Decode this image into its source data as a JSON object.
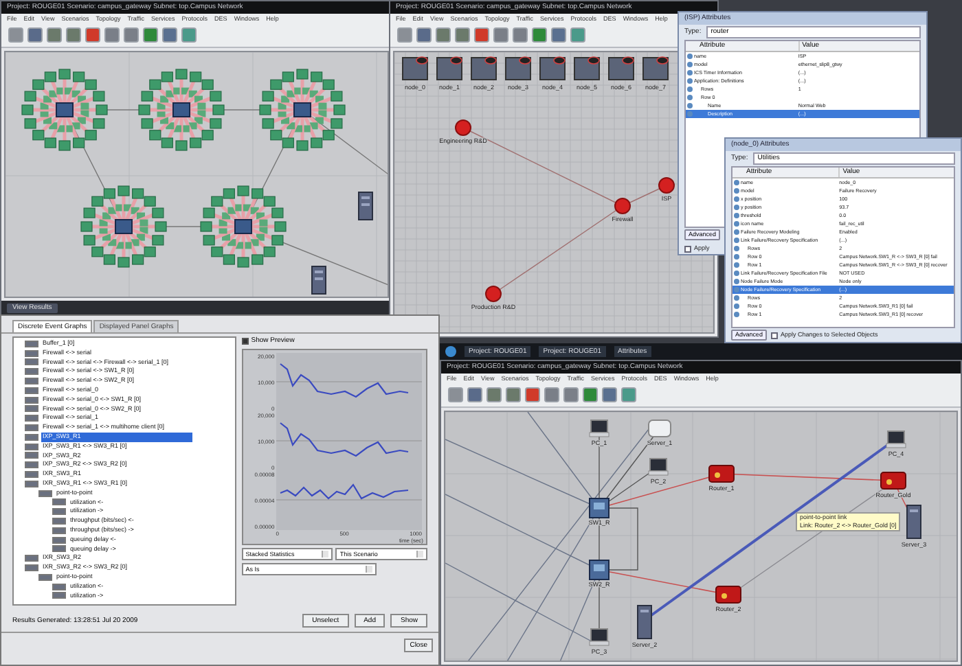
{
  "editor_top_left": {
    "title": "Project: ROUGE01 Scenario: campus_gateway Subnet: top.Campus Network",
    "menu": [
      "File",
      "Edit",
      "View",
      "Scenarios",
      "Topology",
      "Traffic",
      "Services",
      "Protocols",
      "DES",
      "Windows",
      "Help"
    ],
    "minimized": "View Results"
  },
  "editor_top_center": {
    "title": "Project: ROUGE01 Scenario: campus_gateway Subnet: top.Campus Network",
    "menu": [
      "File",
      "Edit",
      "View",
      "Scenarios",
      "Topology",
      "Traffic",
      "Services",
      "Protocols",
      "DES",
      "Windows",
      "Help"
    ],
    "palette": [
      "node_0",
      "node_1",
      "node_2",
      "node_3",
      "node_4",
      "node_5",
      "node_6",
      "node_7"
    ],
    "sites": [
      "Engineering R&D",
      "Firewall",
      "ISP",
      "Production R&D"
    ]
  },
  "attributes_window": {
    "title": "(ISP) Attributes",
    "type_label": "Type:",
    "type_value": "router",
    "columns": [
      "Attribute",
      "Value"
    ],
    "rows": [
      {
        "attribute": "name",
        "value": "ISP",
        "selected": false
      },
      {
        "attribute": "model",
        "value": "ethernet_slip8_gtwy",
        "selected": false
      },
      {
        "attribute": "ICS Timer Information",
        "value": "(...)",
        "selected": false
      },
      {
        "attribute": "Application: Definitions",
        "value": "(...)",
        "selected": false,
        "children": [
          {
            "attribute": "Rows",
            "value": "1",
            "selected": false
          },
          {
            "attribute": "Row 0",
            "selected": false,
            "children": [
              {
                "attribute": "Name",
                "value": "Normal Web",
                "selected": false
              },
              {
                "attribute": "Description",
                "value": "(...)",
                "selected": true
              }
            ]
          }
        ]
      }
    ],
    "advanced": "Advanced",
    "apply": "Apply",
    "apply_checked": false
  },
  "failure_window": {
    "title": "(node_0) Attributes",
    "type_label": "Type:",
    "type_value": "Utilities",
    "columns": [
      "Attribute",
      "Value"
    ],
    "rows": [
      {
        "attribute": "name",
        "value": "node_0",
        "selected": false
      },
      {
        "attribute": "model",
        "value": "Failure Recovery",
        "selected": false
      },
      {
        "attribute": "x position",
        "value": "100",
        "selected": false
      },
      {
        "attribute": "y position",
        "value": "93.7",
        "selected": false
      },
      {
        "attribute": "threshold",
        "value": "0.0",
        "selected": false
      },
      {
        "attribute": "icon name",
        "value": "fail_rec_util",
        "selected": false
      },
      {
        "attribute": "Failure Recovery Modeling",
        "value": "Enabled",
        "selected": false
      },
      {
        "attribute": "Link Failure/Recovery Specification",
        "value": "(...)",
        "selected": false,
        "children": [
          {
            "attribute": "Rows",
            "value": "2",
            "selected": false
          },
          {
            "attribute": "Row 0",
            "value": "Campus Network.SW1_R <-> SW3_R [0] fail",
            "selected": false
          },
          {
            "attribute": "Row 1",
            "value": "Campus Network.SW1_R <-> SW3_R [0] recover",
            "selected": false
          }
        ]
      },
      {
        "attribute": "Link Failure/Recovery Specification File",
        "value": "NOT USED",
        "selected": false
      },
      {
        "attribute": "Node Failure Mode",
        "value": "Node only",
        "selected": false
      },
      {
        "attribute": "Node Failure/Recovery Specification",
        "value": "(...)",
        "selected": true,
        "children": [
          {
            "attribute": "Rows",
            "value": "2",
            "selected": false
          },
          {
            "attribute": "Row 0",
            "value": "Campus Network.SW3_R1 [0] fail",
            "selected": false
          },
          {
            "attribute": "Row 1",
            "value": "Campus Network.SW3_R1 [0] recover",
            "selected": false
          }
        ]
      }
    ],
    "advanced": "Advanced",
    "apply": "Apply Changes to Selected Objects",
    "apply_checked": false
  },
  "results": {
    "tabs": [
      {
        "label": "Discrete Event Graphs",
        "selected": true
      },
      {
        "label": "Displayed Panel Graphs",
        "selected": false
      }
    ],
    "tree": [
      {
        "label": "Buffer_1 [0]",
        "selected": false
      },
      {
        "label": "Firewall <-> serial",
        "selected": false
      },
      {
        "label": "Firewall <-> serial <-> Firewall <-> serial_1 [0]",
        "selected": false
      },
      {
        "label": "Firewall <-> serial <-> SW1_R [0]",
        "selected": false
      },
      {
        "label": "Firewall <-> serial <-> SW2_R [0]",
        "selected": false
      },
      {
        "label": "Firewall <-> serial_0",
        "selected": false
      },
      {
        "label": "Firewall <-> serial_0 <-> SW1_R [0]",
        "selected": false
      },
      {
        "label": "Firewall <-> serial_0 <-> SW2_R [0]",
        "selected": false
      },
      {
        "label": "Firewall <-> serial_1",
        "selected": false
      },
      {
        "label": "Firewall <-> serial_1 <-> multihome client [0]",
        "selected": false
      },
      {
        "label": "IXP_SW3_R1",
        "selected": true
      },
      {
        "label": "IXP_SW3_R1 <-> SW3_R1 [0]",
        "selected": false
      },
      {
        "label": "IXP_SW3_R2",
        "selected": false
      },
      {
        "label": "IXP_SW3_R2 <-> SW3_R2 [0]",
        "selected": false
      },
      {
        "label": "IXR_SW3_R1",
        "selected": false
      },
      {
        "label": "IXR_SW3_R1 <-> SW3_R1 [0]",
        "selected": false,
        "children": [
          {
            "label": "point-to-point",
            "selected": false,
            "children": [
              {
                "label": "utilization <-",
                "selected": false
              },
              {
                "label": "utilization ->",
                "selected": false
              },
              {
                "label": "throughput (bits/sec) <-",
                "selected": false
              },
              {
                "label": "throughput (bits/sec) ->",
                "selected": false
              },
              {
                "label": "queuing delay <-",
                "selected": false
              },
              {
                "label": "queuing delay ->",
                "selected": false
              }
            ]
          }
        ]
      },
      {
        "label": "IXR_SW3_R2",
        "selected": false
      },
      {
        "label": "IXR_SW3_R2 <-> SW3_R2 [0]",
        "selected": false,
        "children": [
          {
            "label": "point-to-point",
            "selected": false,
            "children": [
              {
                "label": "utilization <-",
                "selected": false
              },
              {
                "label": "utilization ->",
                "selected": false
              }
            ]
          }
        ]
      }
    ],
    "preview": {
      "label": "Show Preview",
      "checked": true
    },
    "panels": [
      {
        "yticks": [
          "20,000",
          "10,000",
          "0"
        ]
      },
      {
        "yticks": [
          "20,000",
          "10,000",
          "0"
        ]
      },
      {
        "yticks": [
          "0.00008",
          "0.00004",
          "0.00000"
        ]
      }
    ],
    "xticks": [
      "0",
      "500",
      "1000"
    ],
    "xlabel": "time (sec)",
    "selects": [
      "Stacked Statistics",
      "This Scenario",
      "As Is"
    ],
    "generated": "Results Generated: 13:28:51 Jul 20 2009",
    "buttons": [
      "Unselect",
      "Add",
      "Show"
    ],
    "close": "Close"
  },
  "taskbar": [
    "Project: ROUGE01",
    "Project: ROUGE01",
    "Attributes"
  ],
  "editor_bottom": {
    "title": "Project: ROUGE01 Scenario: campus_gateway Subnet: top.Campus Network",
    "menu": [
      "File",
      "Edit",
      "View",
      "Scenarios",
      "Topology",
      "Traffic",
      "Services",
      "Protocols",
      "DES",
      "Windows",
      "Help"
    ],
    "nodes": [
      "PC_1",
      "Server_1",
      "PC_2",
      "SW1_R",
      "SW2_R",
      "PC_3",
      "Router_1",
      "Router_2",
      "Server_2",
      "PC_4",
      "Router_Gold",
      "Server_3"
    ],
    "tooltip": [
      "point-to-point link",
      "Link: Router_2 <-> Router_Gold [0]"
    ]
  }
}
